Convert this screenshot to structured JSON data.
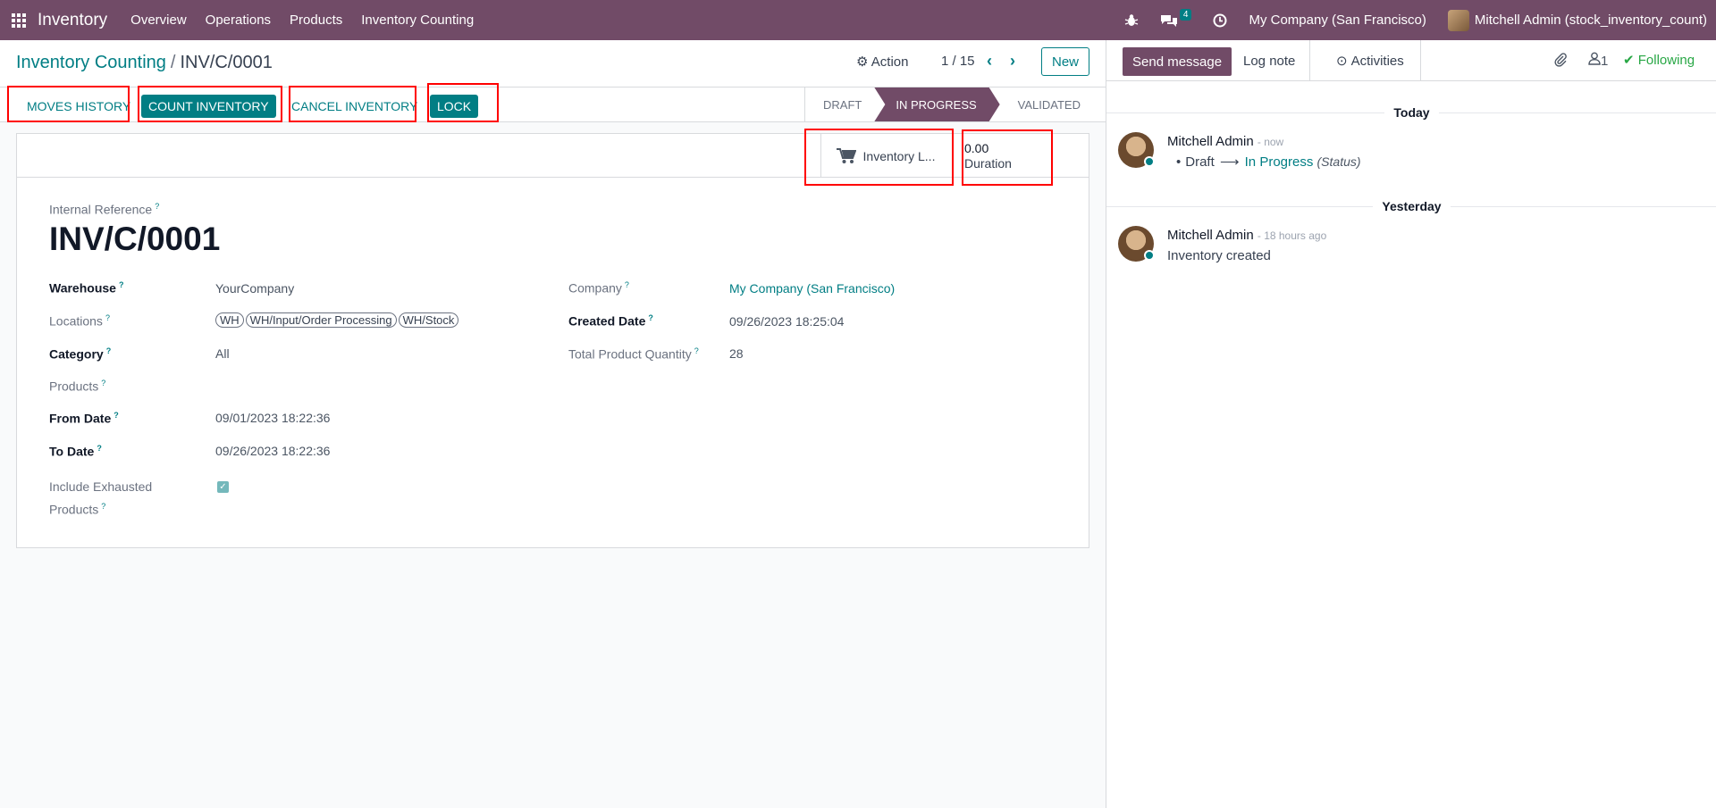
{
  "navbar": {
    "app_name": "Inventory",
    "menus": [
      "Overview",
      "Operations",
      "Products",
      "Inventory Counting"
    ],
    "chat_count": "4",
    "company": "My Company (San Francisco)",
    "user": "Mitchell Admin (stock_inventory_count)"
  },
  "breadcrumb": {
    "parent": "Inventory Counting",
    "separator": "/",
    "current": "INV/C/0001"
  },
  "control": {
    "action_label": "Action",
    "pager": "1 / 15",
    "new_label": "New"
  },
  "statusbar": {
    "buttons": [
      "MOVES HISTORY",
      "COUNT INVENTORY",
      "CANCEL INVENTORY",
      "LOCK"
    ],
    "stages": [
      "DRAFT",
      "IN PROGRESS",
      "VALIDATED"
    ],
    "active_stage": "IN PROGRESS"
  },
  "smart_buttons": {
    "inventory_lines": "Inventory L...",
    "duration_value": "0.00",
    "duration_label": "Duration"
  },
  "form": {
    "ref_label": "Internal Reference",
    "ref_value": "INV/C/0001",
    "warehouse_label": "Warehouse",
    "warehouse_value": "YourCompany",
    "locations_label": "Locations",
    "locations": [
      "WH",
      "WH/Input/Order Processing",
      "WH/Stock"
    ],
    "category_label": "Category",
    "category_value": "All",
    "products_label": "Products",
    "from_label": "From Date",
    "from_value": "09/01/2023 18:22:36",
    "to_label": "To Date",
    "to_value": "09/26/2023 18:22:36",
    "exhausted_label_1": "Include Exhausted",
    "exhausted_label_2": "Products",
    "company_label": "Company",
    "company_value": "My Company (San Francisco)",
    "created_label": "Created Date",
    "created_value": "09/26/2023 18:25:04",
    "total_label": "Total Product Quantity",
    "total_value": "28"
  },
  "chatter": {
    "send_label": "Send message",
    "log_label": "Log note",
    "activities_label": "Activities",
    "followers_count": "1",
    "following_label": "Following",
    "today": "Today",
    "yesterday": "Yesterday",
    "msg1_author": "Mitchell Admin",
    "msg1_time": "- now",
    "msg1_from": "Draft",
    "msg1_to": "In Progress",
    "msg1_field": "(Status)",
    "msg2_author": "Mitchell Admin",
    "msg2_time": "- 18 hours ago",
    "msg2_body": "Inventory created"
  },
  "colors": {
    "brand": "#714b67",
    "accent": "#017e84",
    "highlight": "#ff0000"
  }
}
